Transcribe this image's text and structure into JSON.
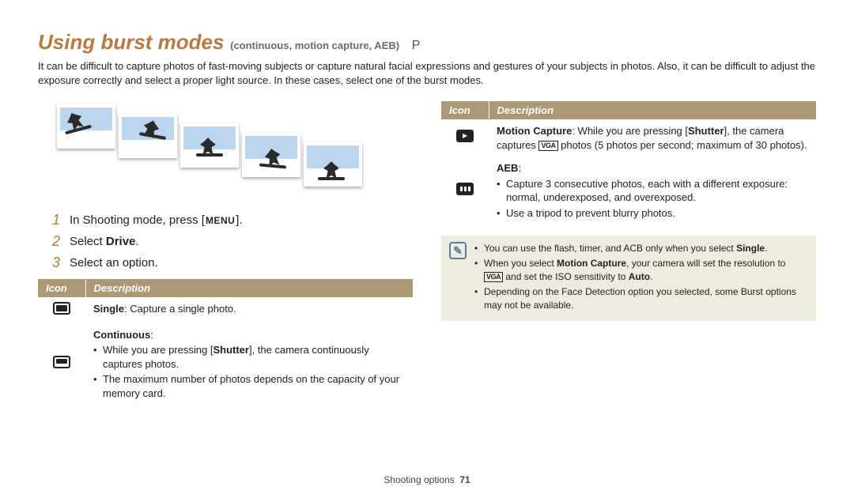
{
  "header": {
    "title_main": "Using burst modes",
    "title_sub": "(continuous, motion capture, AEB)",
    "title_p": "P",
    "intro": "It can be difficult to capture photos of fast-moving subjects or capture natural facial expressions and gestures of your subjects in photos. Also, it can be difficult to adjust the exposure correctly and select a proper light source. In these cases, select one of the burst modes."
  },
  "steps": [
    {
      "num": "1",
      "pre": "In Shooting mode, press [",
      "btn": "MENU",
      "post": "]."
    },
    {
      "num": "2",
      "pre": "Select ",
      "bold": "Drive",
      "post": "."
    },
    {
      "num": "3",
      "pre": "Select an option.",
      "bold": "",
      "post": ""
    }
  ],
  "table_left": {
    "headers": {
      "icon": "Icon",
      "desc": "Description"
    },
    "rows": [
      {
        "icon_kind": "solid",
        "title": "Single",
        "after_title": ": Capture a single photo."
      },
      {
        "icon_kind": "multi",
        "title": "Continuous",
        "after_title": ":",
        "bullets": [
          {
            "pre": "While you are pressing [",
            "bold": "Shutter",
            "post": "], the camera continuously captures photos."
          },
          {
            "pre": "The maximum number of photos depends on the capacity of your memory card."
          }
        ]
      }
    ]
  },
  "table_right": {
    "headers": {
      "icon": "Icon",
      "desc": "Description"
    },
    "rows": [
      {
        "icon_kind": "motion",
        "title": "Motion Capture",
        "line": {
          "a": ": While you are pressing [",
          "b": "Shutter",
          "c": "], the camera captures ",
          "vga": "VGA",
          "d": " photos (5 photos per second; maximum of 30 photos)."
        }
      },
      {
        "icon_kind": "aeb",
        "title": "AEB",
        "after_title": ":",
        "bullets": [
          {
            "pre": "Capture 3 consecutive photos, each with a different exposure: normal, underexposed, and overexposed."
          },
          {
            "pre": "Use a tripod to prevent blurry photos."
          }
        ]
      }
    ]
  },
  "note": {
    "bullets": [
      {
        "a": "You can use the flash, timer, and ACB only when you select ",
        "b": "Single",
        "c": "."
      },
      {
        "a": "When you select ",
        "b": "Motion Capture",
        "c": ", your camera will set the resolution to ",
        "vga": "VGA",
        "d": " and set the ISO sensitivity to ",
        "e": "Auto",
        "f": "."
      },
      {
        "a": "Depending on the Face Detection option you selected, some Burst options may not be available."
      }
    ]
  },
  "footer": {
    "section": "Shooting options",
    "page": "71"
  }
}
